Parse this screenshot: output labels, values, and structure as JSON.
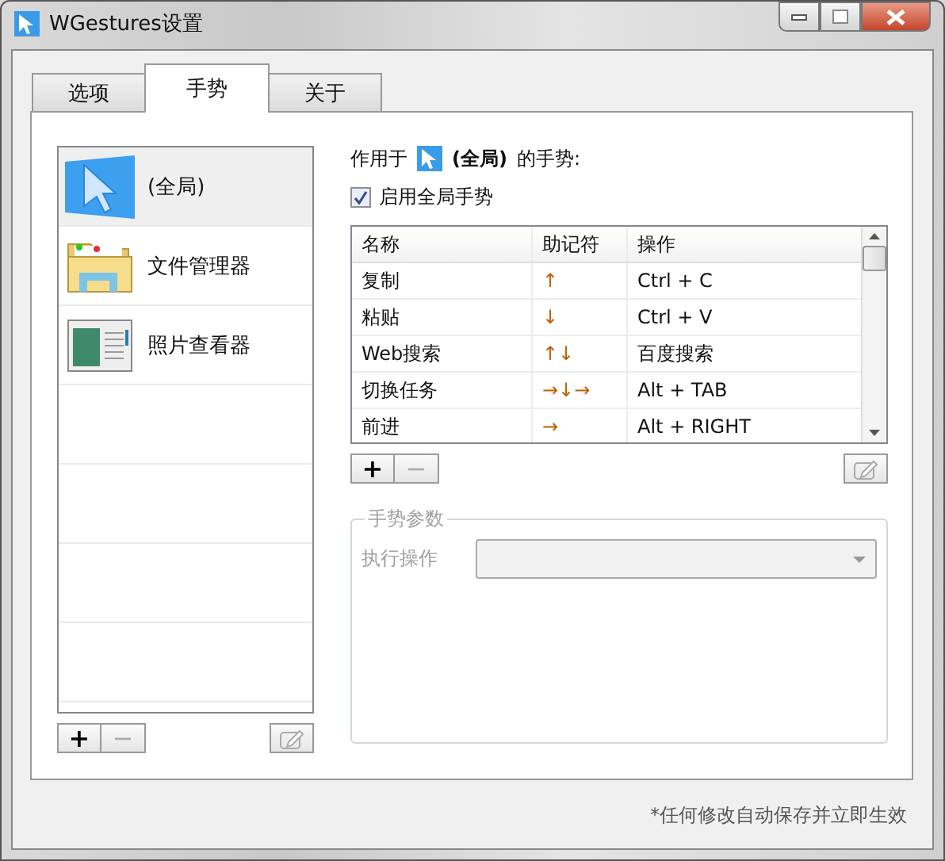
{
  "window": {
    "title": "WGestures设置"
  },
  "tabs": [
    {
      "label": "选项",
      "selected": false
    },
    {
      "label": "手势",
      "selected": true
    },
    {
      "label": "关于",
      "selected": false
    }
  ],
  "apps": [
    {
      "name": "(全局)",
      "kind": "global",
      "selected": true
    },
    {
      "name": "文件管理器",
      "kind": "folder",
      "selected": false
    },
    {
      "name": "照片查看器",
      "kind": "viewer",
      "selected": false
    }
  ],
  "app_buttons": {
    "add": {
      "label": "+",
      "disabled": false
    },
    "remove": {
      "label": "−",
      "disabled": true
    },
    "edit": {
      "disabled": true
    }
  },
  "header": {
    "prefix": "作用于",
    "app": "(全局)",
    "suffix": "的手势:"
  },
  "enable_checkbox": {
    "label": "启用全局手势",
    "checked": true
  },
  "gesture_table": {
    "columns": [
      "名称",
      "助记符",
      "操作"
    ],
    "rows": [
      {
        "name": "复制",
        "mnemonic": "↑",
        "action": "Ctrl + C",
        "selected": false
      },
      {
        "name": "粘贴",
        "mnemonic": "↓",
        "action": "Ctrl + V",
        "selected": false
      },
      {
        "name": "Web搜索",
        "mnemonic": "↑↓",
        "action": "百度搜索",
        "selected": false
      },
      {
        "name": "切换任务",
        "mnemonic": "→↓→",
        "action": "Alt + TAB",
        "selected": false
      },
      {
        "name": "前进",
        "mnemonic": "→",
        "action": "Alt + RIGHT",
        "selected": false
      }
    ]
  },
  "gesture_buttons": {
    "add": {
      "label": "+",
      "disabled": false
    },
    "remove": {
      "label": "−",
      "disabled": true
    },
    "edit": {
      "disabled": true
    }
  },
  "params": {
    "title": "手势参数",
    "label": "执行操作",
    "disabled": true
  },
  "footer": "*任何修改自动保存并立即生效"
}
